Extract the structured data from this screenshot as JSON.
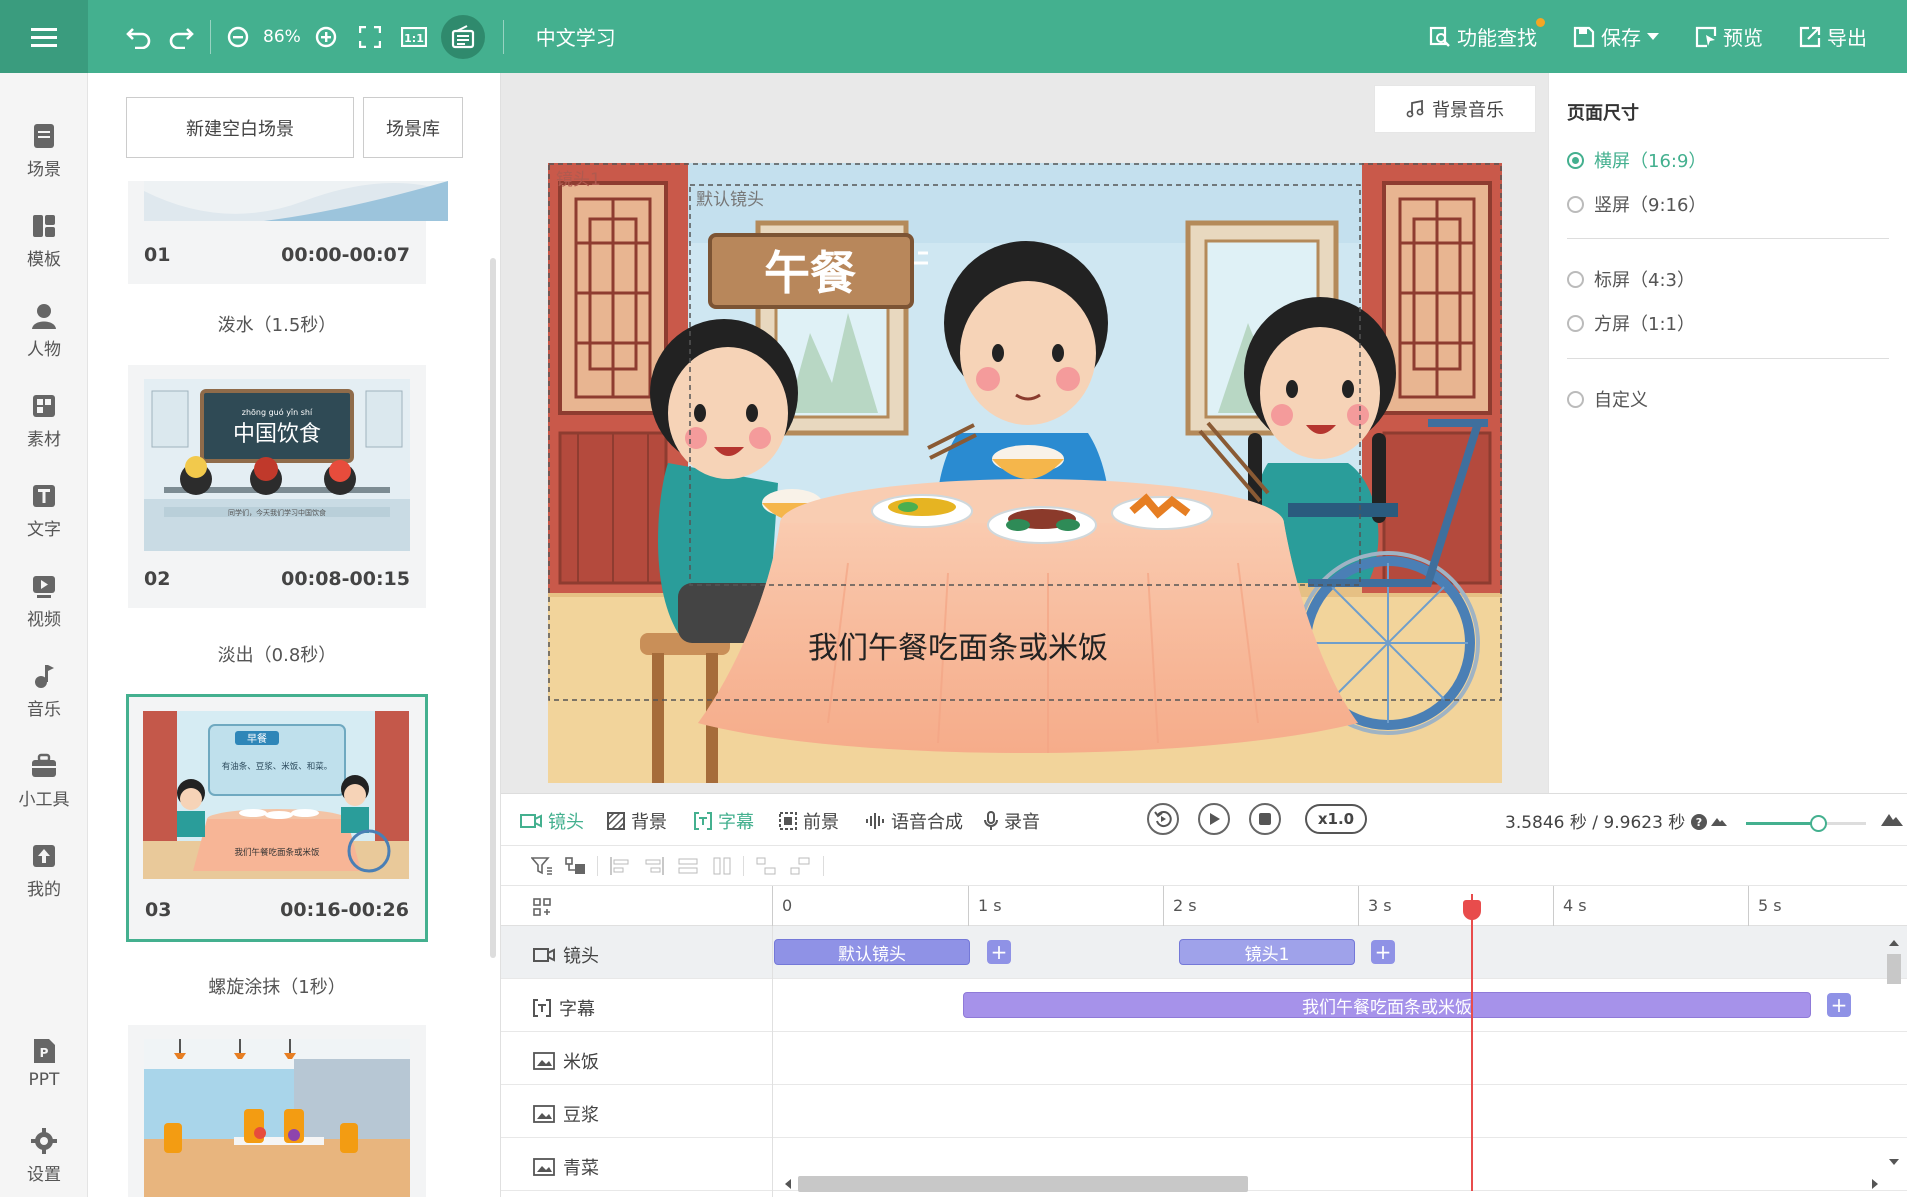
{
  "topbar": {
    "zoom": "86%",
    "doc_title": "中文学习",
    "feature_search": "功能查找",
    "save": "保存",
    "preview": "预览",
    "export": "导出"
  },
  "leftrail": {
    "items": [
      {
        "label": "场景",
        "icon": "scene-icon"
      },
      {
        "label": "模板",
        "icon": "template-icon"
      },
      {
        "label": "人物",
        "icon": "person-icon"
      },
      {
        "label": "素材",
        "icon": "material-icon"
      },
      {
        "label": "文字",
        "icon": "text-icon"
      },
      {
        "label": "视频",
        "icon": "video-icon"
      },
      {
        "label": "音乐",
        "icon": "music-icon"
      },
      {
        "label": "小工具",
        "icon": "toolbox-icon"
      },
      {
        "label": "我的",
        "icon": "upload-icon"
      },
      {
        "label": "PPT",
        "icon": "ppt-icon"
      },
      {
        "label": "设置",
        "icon": "gear-icon"
      }
    ]
  },
  "scenes": {
    "new_blank": "新建空白场景",
    "library": "场景库",
    "cards": [
      {
        "num": "01",
        "time": "00:00-00:07"
      },
      {
        "num": "02",
        "time": "00:08-00:15"
      },
      {
        "num": "03",
        "time": "00:16-00:26"
      }
    ],
    "transitions": [
      "泼水（1.5秒）",
      "淡出（0.8秒）",
      "螺旋涂抹（1秒）"
    ],
    "thumb2_title": "中国饮食",
    "thumb2_pinyin": "zhōng guó yǐn shí",
    "thumb3_title": "早餐",
    "thumb3_text": "有油条、豆浆、米饭、和菜。",
    "thumb3_sub": "我们午餐吃面条或米饭"
  },
  "canvas": {
    "bgm": "背景音乐",
    "shot_label": "镜头1",
    "default_shot": "默认镜头",
    "sign_text": "午餐",
    "subtitle": "我们午餐吃面条或米饭"
  },
  "properties": {
    "title": "页面尺寸",
    "options": [
      {
        "label": "横屏（16:9）",
        "selected": true
      },
      {
        "label": "竖屏（9:16）",
        "selected": false
      },
      {
        "label": "标屏（4:3）",
        "selected": false
      },
      {
        "label": "方屏（1:1）",
        "selected": false
      },
      {
        "label": "自定义",
        "selected": false
      }
    ]
  },
  "timeline": {
    "tabs": [
      "镜头",
      "背景",
      "字幕",
      "前景",
      "语音合成",
      "录音"
    ],
    "speed": "x1.0",
    "time_readout": "3.5846 秒 / 9.9623 秒",
    "zoom_fraction": 0.6,
    "ruler": [
      "0",
      "1 s",
      "2 s",
      "3 s",
      "4 s",
      "5 s"
    ],
    "tracks": [
      {
        "label": "镜头",
        "icon": "camera-icon"
      },
      {
        "label": "字幕",
        "icon": "subtitle-icon"
      },
      {
        "label": "米饭",
        "icon": "image-icon"
      },
      {
        "label": "豆浆",
        "icon": "image-icon"
      },
      {
        "label": "青菜",
        "icon": "image-icon"
      }
    ],
    "clips": {
      "default_shot": "默认镜头",
      "shot1": "镜头1",
      "subtitle": "我们午餐吃面条或米饭"
    }
  }
}
